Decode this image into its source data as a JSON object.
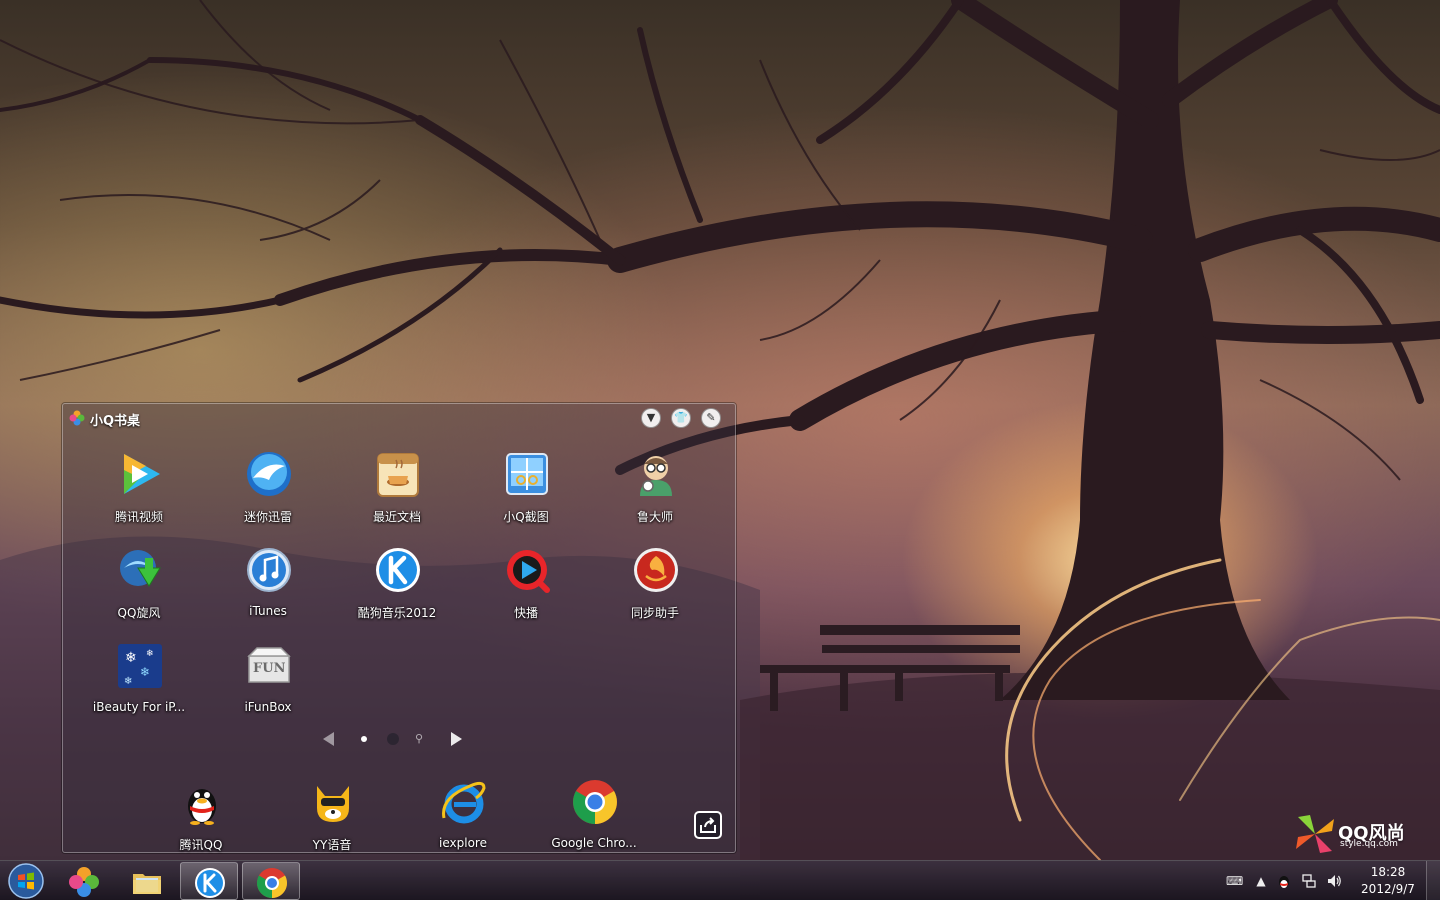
{
  "widget": {
    "title": "小Q书桌",
    "apps": [
      {
        "label": "腾讯视频",
        "icon": "tencent-video-icon"
      },
      {
        "label": "迷你迅雷",
        "icon": "mini-thunder-icon"
      },
      {
        "label": "最近文档",
        "icon": "recent-documents-icon"
      },
      {
        "label": "小Q截图",
        "icon": "screenshot-icon"
      },
      {
        "label": "鲁大师",
        "icon": "ludashi-icon"
      },
      {
        "label": "QQ旋风",
        "icon": "qq-whirlwind-icon"
      },
      {
        "label": "iTunes",
        "icon": "itunes-icon"
      },
      {
        "label": "酷狗音乐2012",
        "icon": "kugou-music-icon"
      },
      {
        "label": "快播",
        "icon": "qvod-icon"
      },
      {
        "label": "同步助手",
        "icon": "sync-assistant-icon"
      },
      {
        "label": "iBeauty For iP...",
        "icon": "ibeauty-icon"
      },
      {
        "label": "iFunBox",
        "icon": "ifunbox-icon"
      }
    ],
    "dock": [
      {
        "label": "腾讯QQ",
        "icon": "qq-penguin-icon"
      },
      {
        "label": "YY语音",
        "icon": "yy-voice-icon"
      },
      {
        "label": "iexplore",
        "icon": "internet-explorer-icon"
      },
      {
        "label": "Google Chro...",
        "icon": "google-chrome-icon"
      }
    ],
    "pager": {
      "current_page": 1,
      "total_pages": 2
    }
  },
  "branding": {
    "name": "QQ风尚",
    "site": "style.qq.com"
  },
  "taskbar": {
    "pinned": [
      "qq-pinwheel-icon",
      "file-explorer-icon",
      "kugou-music-icon",
      "google-chrome-icon"
    ],
    "tray_icons": [
      "keyboard-icon",
      "show-hidden-icons",
      "qq-tray-icon",
      "network-icon",
      "volume-icon"
    ],
    "clock_time": "18:28",
    "clock_date": "2012/9/7"
  }
}
